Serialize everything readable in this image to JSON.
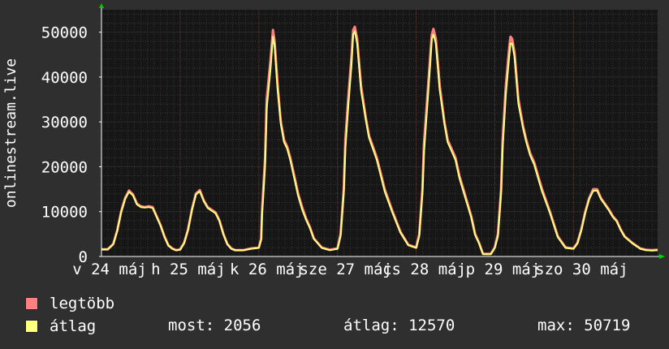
{
  "chart_data": {
    "type": "line",
    "ylabel": "onlinestream.live",
    "ylim": [
      0,
      55000
    ],
    "yticks": [
      0,
      10000,
      20000,
      30000,
      40000,
      50000
    ],
    "ytick_labels": [
      "0",
      "10000",
      "20000",
      "30000",
      "40000",
      "50000"
    ],
    "xlim": [
      0,
      7.07
    ],
    "xticks": [
      {
        "x": 0.0,
        "label": "v 24 máj"
      },
      {
        "x": 1.0,
        "label": "h 25 máj"
      },
      {
        "x": 2.0,
        "label": "k 26 máj"
      },
      {
        "x": 3.0,
        "label": "sze 27 máj"
      },
      {
        "x": 4.0,
        "label": "cs 28 máj"
      },
      {
        "x": 5.0,
        "label": "p 29 máj"
      },
      {
        "x": 6.0,
        "label": "szo 30 máj"
      }
    ],
    "x_unit": "days since 24 máj 00:00",
    "grid": true,
    "series": [
      {
        "name": "legtöbb",
        "color": "#ff8080",
        "x": [
          0.0,
          0.08,
          0.15,
          0.2,
          0.25,
          0.3,
          0.35,
          0.4,
          0.45,
          0.5,
          0.55,
          0.6,
          0.65,
          0.75,
          0.8,
          0.85,
          0.9,
          0.95,
          1.0,
          1.05,
          1.1,
          1.15,
          1.2,
          1.25,
          1.3,
          1.35,
          1.45,
          1.5,
          1.55,
          1.6,
          1.65,
          1.7,
          1.8,
          1.9,
          2.0,
          2.03,
          2.04,
          2.08,
          2.1,
          2.15,
          2.18,
          2.2,
          2.24,
          2.28,
          2.32,
          2.36,
          2.4,
          2.45,
          2.5,
          2.55,
          2.6,
          2.65,
          2.7,
          2.8,
          2.9,
          3.0,
          3.04,
          3.08,
          3.1,
          3.14,
          3.18,
          3.2,
          3.22,
          3.25,
          3.3,
          3.36,
          3.4,
          3.45,
          3.5,
          3.55,
          3.6,
          3.7,
          3.8,
          3.9,
          4.0,
          4.04,
          4.08,
          4.1,
          4.14,
          4.18,
          4.2,
          4.22,
          4.25,
          4.3,
          4.36,
          4.4,
          4.45,
          4.5,
          4.55,
          4.6,
          4.7,
          4.75,
          4.8,
          4.85,
          4.95,
          5.0,
          5.04,
          5.08,
          5.1,
          5.14,
          5.18,
          5.2,
          5.22,
          5.25,
          5.3,
          5.36,
          5.4,
          5.45,
          5.5,
          5.55,
          5.6,
          5.7,
          5.8,
          5.9,
          6.0,
          6.05,
          6.1,
          6.15,
          6.2,
          6.25,
          6.3,
          6.35,
          6.45,
          6.5,
          6.55,
          6.6,
          6.65,
          6.75,
          6.85,
          6.92,
          7.0,
          7.07
        ],
        "y": [
          1600,
          1600,
          2800,
          5800,
          10000,
          13000,
          14700,
          13800,
          11800,
          11200,
          11000,
          11200,
          11000,
          7000,
          4500,
          2500,
          1800,
          1400,
          1600,
          3000,
          6000,
          10500,
          14000,
          14800,
          12500,
          11000,
          9800,
          8000,
          5000,
          2800,
          1800,
          1400,
          1400,
          1800,
          2000,
          4000,
          10000,
          22000,
          35000,
          44000,
          50500,
          48000,
          38000,
          30000,
          26000,
          24500,
          22000,
          18000,
          14000,
          11000,
          8500,
          6500,
          4000,
          2000,
          1500,
          1800,
          5000,
          15000,
          26000,
          36000,
          45000,
          50500,
          51200,
          48500,
          38000,
          31000,
          27000,
          24500,
          22000,
          18500,
          15000,
          10000,
          5500,
          2600,
          2000,
          5000,
          15000,
          25000,
          35000,
          45000,
          49500,
          50719,
          48500,
          38000,
          30000,
          26000,
          24000,
          22000,
          18000,
          15000,
          9000,
          5000,
          3000,
          600,
          600,
          2000,
          5000,
          15000,
          26000,
          38000,
          46000,
          49000,
          48500,
          45500,
          35000,
          29000,
          26000,
          23000,
          21000,
          18000,
          15000,
          10000,
          4500,
          2000,
          1800,
          3000,
          6000,
          10000,
          13000,
          15000,
          15000,
          13000,
          10500,
          9000,
          8000,
          6000,
          4500,
          3000,
          1800,
          1500,
          1400,
          1500
        ]
      },
      {
        "name": "átlag",
        "color": "#ffff80",
        "x": [
          0.0,
          0.08,
          0.15,
          0.2,
          0.25,
          0.3,
          0.35,
          0.4,
          0.45,
          0.5,
          0.55,
          0.6,
          0.65,
          0.75,
          0.8,
          0.85,
          0.9,
          0.95,
          1.0,
          1.05,
          1.1,
          1.15,
          1.2,
          1.25,
          1.3,
          1.35,
          1.45,
          1.5,
          1.55,
          1.6,
          1.65,
          1.7,
          1.8,
          1.9,
          2.0,
          2.03,
          2.04,
          2.08,
          2.1,
          2.15,
          2.18,
          2.2,
          2.24,
          2.28,
          2.32,
          2.36,
          2.4,
          2.45,
          2.5,
          2.55,
          2.6,
          2.65,
          2.7,
          2.8,
          2.9,
          3.0,
          3.04,
          3.08,
          3.1,
          3.14,
          3.18,
          3.2,
          3.22,
          3.25,
          3.3,
          3.36,
          3.4,
          3.45,
          3.5,
          3.55,
          3.6,
          3.7,
          3.8,
          3.9,
          4.0,
          4.04,
          4.08,
          4.1,
          4.14,
          4.18,
          4.2,
          4.22,
          4.25,
          4.3,
          4.36,
          4.4,
          4.45,
          4.5,
          4.55,
          4.6,
          4.7,
          4.75,
          4.8,
          4.85,
          4.95,
          5.0,
          5.04,
          5.08,
          5.1,
          5.14,
          5.18,
          5.2,
          5.22,
          5.25,
          5.3,
          5.36,
          5.4,
          5.45,
          5.5,
          5.55,
          5.6,
          5.7,
          5.8,
          5.9,
          6.0,
          6.05,
          6.1,
          6.15,
          6.2,
          6.25,
          6.3,
          6.35,
          6.45,
          6.5,
          6.55,
          6.6,
          6.65,
          6.75,
          6.85,
          6.92,
          7.0,
          7.07
        ],
        "y": [
          1600,
          1600,
          2700,
          5700,
          9800,
          12800,
          14400,
          13600,
          11600,
          11000,
          10900,
          11000,
          10800,
          6900,
          4400,
          2400,
          1700,
          1400,
          1500,
          2900,
          5900,
          10300,
          13800,
          14500,
          12300,
          10800,
          9600,
          7900,
          4900,
          2700,
          1700,
          1400,
          1400,
          1700,
          1900,
          3700,
          9000,
          20000,
          33000,
          42000,
          49000,
          47000,
          37000,
          29500,
          25500,
          24000,
          21500,
          17500,
          13500,
          10500,
          8200,
          6300,
          3900,
          1900,
          1400,
          1700,
          4500,
          14000,
          24000,
          34000,
          43000,
          49500,
          50200,
          47500,
          37000,
          30500,
          26500,
          24000,
          21500,
          18000,
          14500,
          9700,
          5300,
          2500,
          1900,
          4500,
          14000,
          23000,
          33000,
          43000,
          48500,
          49500,
          47500,
          37000,
          29500,
          25500,
          23500,
          21500,
          17500,
          14500,
          8700,
          4800,
          2900,
          500,
          500,
          1900,
          4500,
          14000,
          24000,
          36000,
          44000,
          47500,
          47500,
          44500,
          34000,
          28500,
          25500,
          22500,
          20500,
          17500,
          14500,
          9700,
          4300,
          1900,
          1700,
          2900,
          5800,
          9700,
          12800,
          14600,
          14700,
          12800,
          10300,
          8800,
          7800,
          5900,
          4400,
          2900,
          1700,
          1400,
          1300,
          1400
        ]
      }
    ]
  },
  "legend": {
    "items": [
      {
        "label": "legtöbb",
        "color": "#ff8080"
      },
      {
        "label": "átlag",
        "color": "#ffff80"
      }
    ],
    "stats": {
      "now": "most: 2056",
      "avg": "átlag: 12570",
      "max": "max: 50719"
    }
  }
}
